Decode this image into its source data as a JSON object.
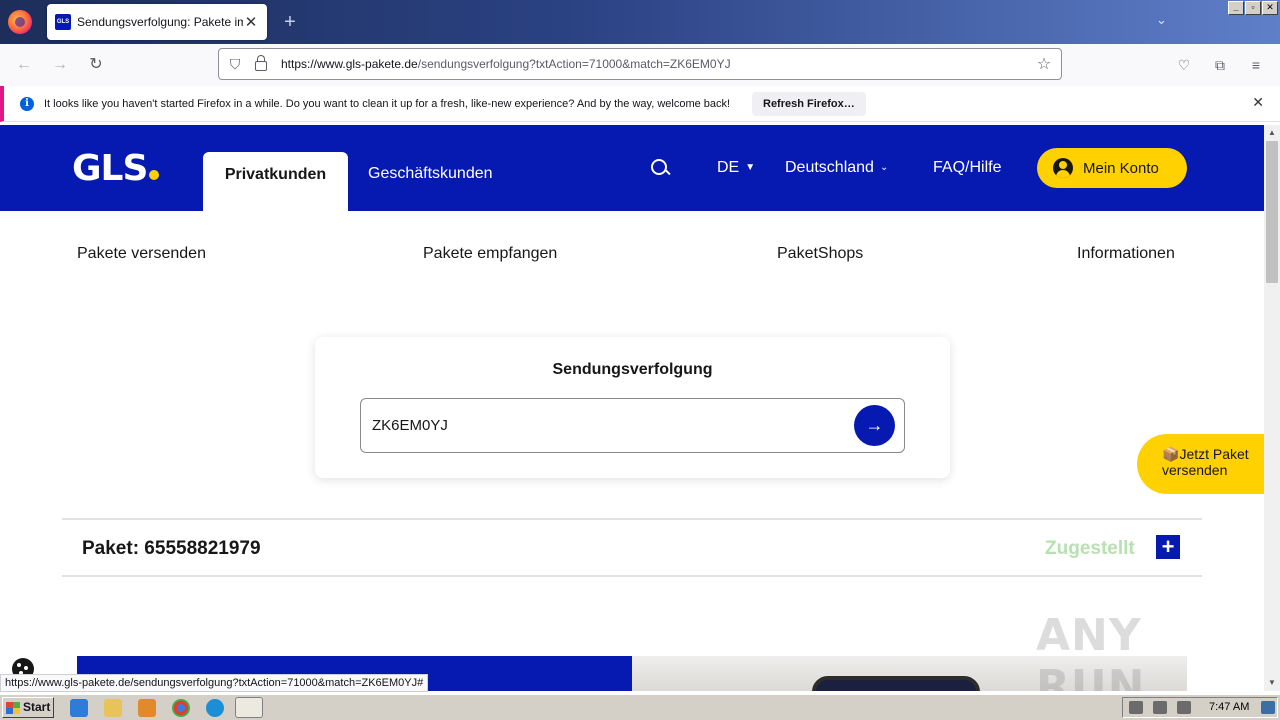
{
  "browser": {
    "tab_title": "Sendungsverfolgung: Pakete im",
    "tab_favicon_text": "GLS",
    "url_domain": "https://www.gls-pakete.de",
    "url_path": "/sendungsverfolgung?txtAction=71000&match=ZK6EM0YJ",
    "notification": {
      "message": "It looks like you haven't started Firefox in a while. Do you want to clean it up for a fresh, like-new experience? And by the way, welcome back!",
      "button": "Refresh Firefox…"
    },
    "status_url": "https://www.gls-pakete.de/sendungsverfolgung?txtAction=71000&match=ZK6EM0YJ#"
  },
  "site": {
    "logo": "GLS",
    "tabs": [
      "Privatkunden",
      "Geschäftskunden"
    ],
    "language": "DE",
    "country": "Deutschland",
    "faq": "FAQ/Hilfe",
    "account_button": "Mein Konto",
    "subnav": [
      "Pakete versenden",
      "Pakete empfangen",
      "PaketShops",
      "Informationen"
    ],
    "tracking": {
      "title": "Sendungsverfolgung",
      "input_value": "ZK6EM0YJ"
    },
    "package": {
      "label": "Paket: 65558821979",
      "status": "Zugestellt"
    },
    "float_button_line1": "Jetzt Paket",
    "float_button_line2": "versenden"
  },
  "taskbar": {
    "start": "Start",
    "clock": "7:47 AM"
  },
  "watermark": "ANY RUN",
  "colors": {
    "gls_blue": "#061ab1",
    "gls_yellow": "#ffd100",
    "status_green": "#b8e0b0"
  }
}
